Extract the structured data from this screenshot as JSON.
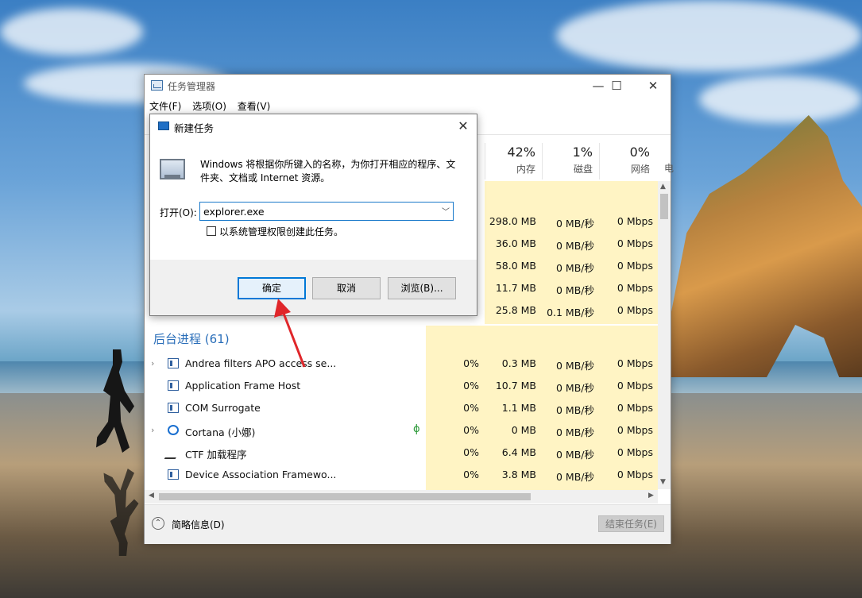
{
  "task_manager": {
    "title": "任务管理器",
    "menu": [
      "文件(F)",
      "选项(O)",
      "查看(V)"
    ],
    "window_controls": {
      "minimize": "—",
      "maximize": "☐",
      "close": "✕"
    },
    "columns": [
      {
        "pct": "42%",
        "label": "内存"
      },
      {
        "pct": "1%",
        "label": "磁盘"
      },
      {
        "pct": "0%",
        "label": "网络"
      }
    ],
    "column_partial": "电",
    "top_rows": [
      {
        "mem": "298.0 MB",
        "disk": "0 MB/秒",
        "net": "0 Mbps"
      },
      {
        "mem": "36.0 MB",
        "disk": "0 MB/秒",
        "net": "0 Mbps"
      },
      {
        "mem": "58.0 MB",
        "disk": "0 MB/秒",
        "net": "0 Mbps"
      },
      {
        "mem": "11.7 MB",
        "disk": "0 MB/秒",
        "net": "0 Mbps"
      },
      {
        "mem": "25.8 MB",
        "disk": "0.1 MB/秒",
        "net": "0 Mbps"
      }
    ],
    "section_title": "后台进程 (61)",
    "processes": [
      {
        "name": "Andrea filters APO access se...",
        "expand": "›",
        "cpu": "0%",
        "mem": "0.3 MB",
        "disk": "0 MB/秒",
        "net": "0 Mbps"
      },
      {
        "name": "Application Frame Host",
        "expand": "",
        "cpu": "0%",
        "mem": "10.7 MB",
        "disk": "0 MB/秒",
        "net": "0 Mbps"
      },
      {
        "name": "COM Surrogate",
        "expand": "",
        "cpu": "0%",
        "mem": "1.1 MB",
        "disk": "0 MB/秒",
        "net": "0 Mbps"
      },
      {
        "name": "Cortana (小娜)",
        "expand": "›",
        "cpu": "0%",
        "mem": "0 MB",
        "disk": "0 MB/秒",
        "net": "0 Mbps"
      },
      {
        "name": "CTF 加载程序",
        "expand": "",
        "cpu": "0%",
        "mem": "6.4 MB",
        "disk": "0 MB/秒",
        "net": "0 Mbps"
      },
      {
        "name": "Device Association Framewo...",
        "expand": "",
        "cpu": "0%",
        "mem": "3.8 MB",
        "disk": "0 MB/秒",
        "net": "0 Mbps"
      }
    ],
    "fewer_details": "简略信息(D)",
    "end_task": "结束任务(E)"
  },
  "new_task_dialog": {
    "title": "新建任务",
    "close": "✕",
    "description": "Windows 将根据你所键入的名称，为你打开相应的程序、文件夹、文档或 Internet 资源。",
    "open_label": "打开(O):",
    "open_value": "explorer.exe",
    "admin_checkbox_label": "以系统管理权限创建此任务。",
    "admin_checked": false,
    "ok": "确定",
    "cancel": "取消",
    "browse": "浏览(B)..."
  },
  "colors": {
    "accent": "#0078d7",
    "section_blue": "#2a6eb9",
    "cell_highlight": "#fff4c4",
    "annotation_arrow": "#e0262a"
  }
}
